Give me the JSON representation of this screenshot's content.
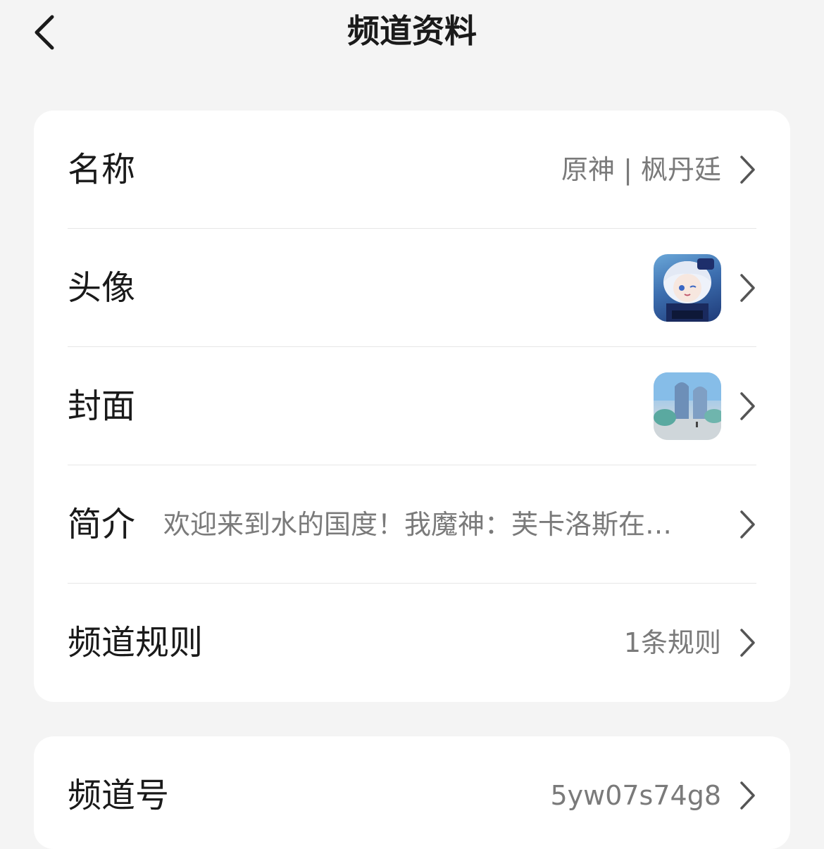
{
  "nav": {
    "title": "频道资料",
    "back_icon": "chevron-left-icon"
  },
  "info": {
    "rows": [
      {
        "key": "name",
        "label": "名称",
        "value": "原神 | 枫丹廷"
      },
      {
        "key": "avatar",
        "label": "头像",
        "image": "channel-avatar-image"
      },
      {
        "key": "cover",
        "label": "封面",
        "image": "channel-cover-image"
      },
      {
        "key": "intro",
        "label": "简介",
        "value": "欢迎来到水的国度！我魔神：芙卡洛斯在…"
      },
      {
        "key": "rules",
        "label": "频道规则",
        "value": "1条规则"
      }
    ]
  },
  "second": {
    "rows": [
      {
        "key": "channel_id",
        "label": "频道号",
        "value": "5yw07s74g8"
      }
    ]
  },
  "colors": {
    "background": "#f4f4f4",
    "card": "#ffffff",
    "label": "#1a1a1a",
    "value": "#7a7a7a",
    "divider": "#e6e6e6"
  }
}
